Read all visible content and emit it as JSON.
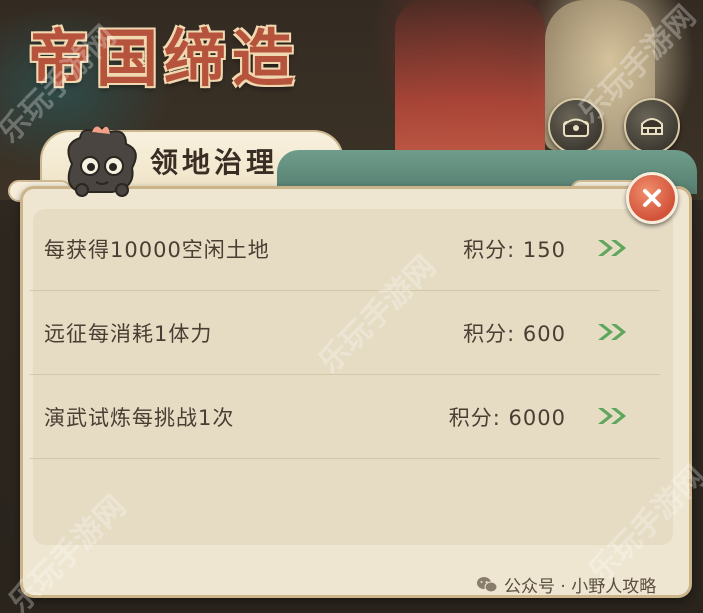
{
  "banner": {
    "title": "帝国缔造"
  },
  "top_buttons": [
    {
      "label": "奖励",
      "icon": "reward-chest-icon"
    },
    {
      "label": "排行",
      "icon": "ranking-podium-icon"
    }
  ],
  "panel": {
    "title": "领地治理",
    "rows": [
      {
        "task": "每获得10000空闲土地",
        "score": "积分: 150"
      },
      {
        "task": "远征每消耗1体力",
        "score": "积分: 600"
      },
      {
        "task": "演武试炼每挑战1次",
        "score": "积分: 6000"
      }
    ]
  },
  "watermark": {
    "text": "乐玩手游网"
  },
  "footer": {
    "text": "公众号 · 小野人攻略"
  },
  "colors": {
    "accent_green": "#5fa65a",
    "close_red": "#d2523a",
    "panel_bg": "#efe6d2"
  }
}
